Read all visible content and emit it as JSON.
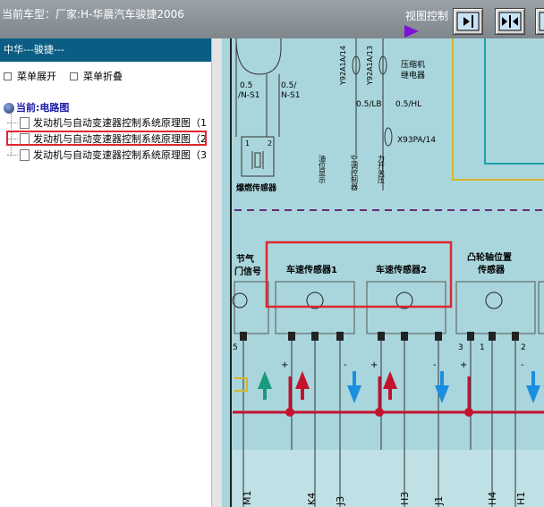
{
  "header": {
    "vehicle": "当前车型：厂家:H-华晨汽车骏捷2006",
    "view_control": "视图控制"
  },
  "sidebar": {
    "title": "中华---骏捷---",
    "expand": "菜单展开",
    "collapse": "菜单折叠",
    "tree_root": "当前:电路图",
    "items": [
      {
        "label": "发动机与自动变速器控制系统原理图（1",
        "selected": false
      },
      {
        "label": "发动机与自动变速器控制系统原理图（2",
        "selected": true
      },
      {
        "label": "发动机与自动变速器控制系统原理图（3",
        "selected": false
      }
    ]
  },
  "diagram": {
    "top_wires": [
      "0.5",
      "/N-S1",
      "0.5/",
      "N-S1"
    ],
    "relay_codes": [
      "Y92A1A/14",
      "Y92A1A/13"
    ],
    "relay_name": [
      "压缩机",
      "继电器"
    ],
    "wire_labels": [
      "0.5/LB",
      "0.5/HL",
      "X93PA/14"
    ],
    "knock_pins": [
      "1",
      "2"
    ],
    "knock_sensor": "爆燃传感器",
    "vertical_labels": [
      "油位显示",
      "空调控制器",
      "力开关压"
    ],
    "throttle": [
      "节气",
      "门信号"
    ],
    "speed_sensor_1": "车速传感器1",
    "speed_sensor_2": "车速传感器2",
    "cam_sensor": [
      "凸轮轴位置",
      "传感器"
    ],
    "pin_nums": [
      "5",
      "3",
      "1",
      "2"
    ],
    "signs": [
      "+",
      "-",
      "+",
      "-",
      "+",
      "-"
    ],
    "connectors": [
      "M1",
      "K4",
      "J3",
      "H3",
      "J1",
      "H4",
      "H1"
    ]
  },
  "colors": {
    "header_bg": "#8a9298",
    "sidebar_header": "#0b5d84",
    "selection": "#e0262e",
    "diagram_bg": "#a9d6dc",
    "wire_red": "#c4122d",
    "arrow_green": "#1a9a7a",
    "arrow_blue": "#1a8ee0",
    "dash_purple": "#6a2a7a"
  },
  "icons": [
    "play-icon",
    "panel-right-icon",
    "panel-center-icon",
    "panel-left-icon",
    "globe-icon",
    "document-icon"
  ]
}
